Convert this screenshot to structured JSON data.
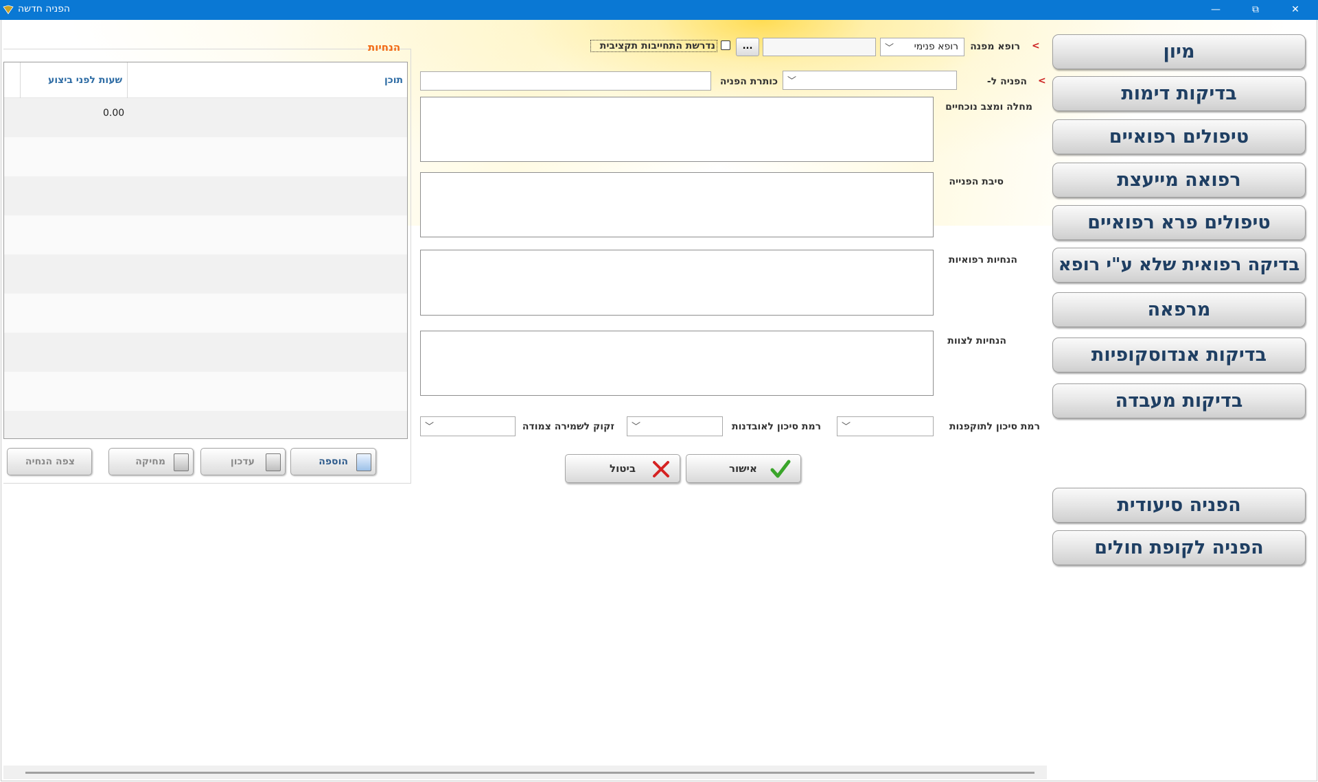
{
  "window": {
    "title": "הפניה חדשה",
    "minimize": "—",
    "restore": "⧉",
    "close": "✕"
  },
  "nav": {
    "buttons": [
      "מיון",
      "בדיקות דימות",
      "טיפולים רפואיים",
      "רפואה מייעצת",
      "טיפולים פרא רפואיים",
      "בדיקה רפואית שלא ע\"י רופא",
      "מרפאה",
      "בדיקות אנדוסקופיות",
      "בדיקות מעבדה"
    ],
    "bottom_buttons": [
      "הפניה סיעודית",
      "הפניה לקופת חולים"
    ]
  },
  "form": {
    "required_marker": "<",
    "referring_doctor_label": "רופא מפנה",
    "referring_doctor_value": "רופא פנימי",
    "doctor_name_value": "",
    "browse_label": "...",
    "budget_checkbox_label": "נדרשת התחייבות תקציבית",
    "budget_checked": false,
    "referral_to_label": "הפניה ל-",
    "referral_to_value": "",
    "referral_title_label": "כותרת הפניה",
    "referral_title_value": "",
    "illness_label": "מחלה ומצב נוכחיים",
    "reason_label": "סיבת הפנייה",
    "medical_instructions_label": "הנחיות רפואיות",
    "staff_instructions_label": "הנחיות לצוות",
    "violence_risk_label": "רמת סיכון לתוקפנות",
    "suicide_risk_label": "רמת סיכון לאובדנות",
    "close_watch_label": "זקוק לשמירה צמודה",
    "ok_label": "אישור",
    "cancel_label": "ביטול"
  },
  "notes": {
    "title": "הנחיות",
    "columns": {
      "content": "תוכן",
      "hours_before": "שעות לפני ביצוע"
    },
    "rows": [
      {
        "content": "",
        "hours": "0.00"
      }
    ],
    "buttons": {
      "add": "הוספה",
      "update": "עדכון",
      "delete": "מחיקה",
      "view": "צפה הנחיה"
    }
  },
  "colors": {
    "titlebar": "#0a78d4",
    "nav_text": "#1f3f63",
    "notes_title": "#f26a14",
    "grid_header": "#2e6ca4",
    "required": "#cc1f1f"
  }
}
